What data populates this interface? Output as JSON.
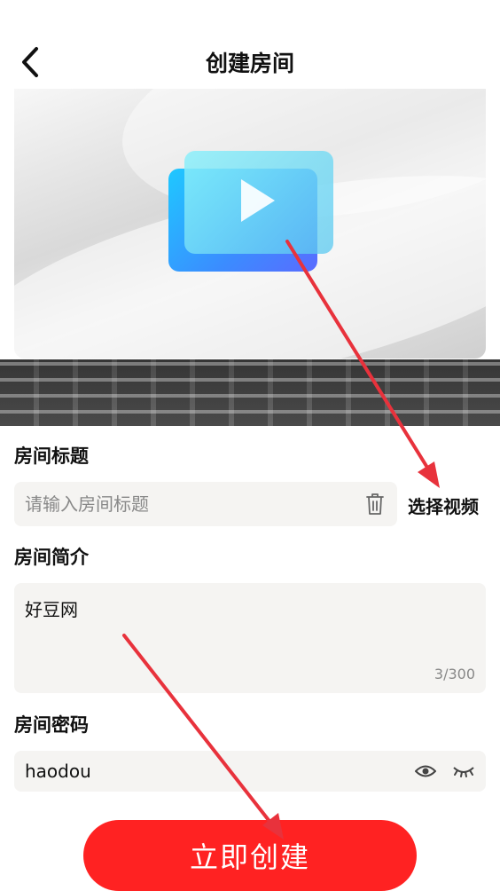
{
  "header": {
    "title": "创建房间",
    "back_icon": "chevron-left-icon"
  },
  "video": {
    "preview_icon": "video-play-icon"
  },
  "room_title": {
    "label": "房间标题",
    "placeholder": "请输入房间标题",
    "clear_icon": "trash-icon"
  },
  "choose_video_label": "选择视频",
  "room_desc": {
    "label": "房间简介",
    "value": "好豆网",
    "counter": "3/300"
  },
  "room_password": {
    "label": "房间密码",
    "value": "haodou",
    "show_icon": "eye-icon",
    "hide_icon": "eye-closed-icon"
  },
  "create_button_label": "立即创建",
  "colors": {
    "primary": "#ff2222",
    "input_bg": "#f5f4f2",
    "annotation": "#e8323c"
  }
}
